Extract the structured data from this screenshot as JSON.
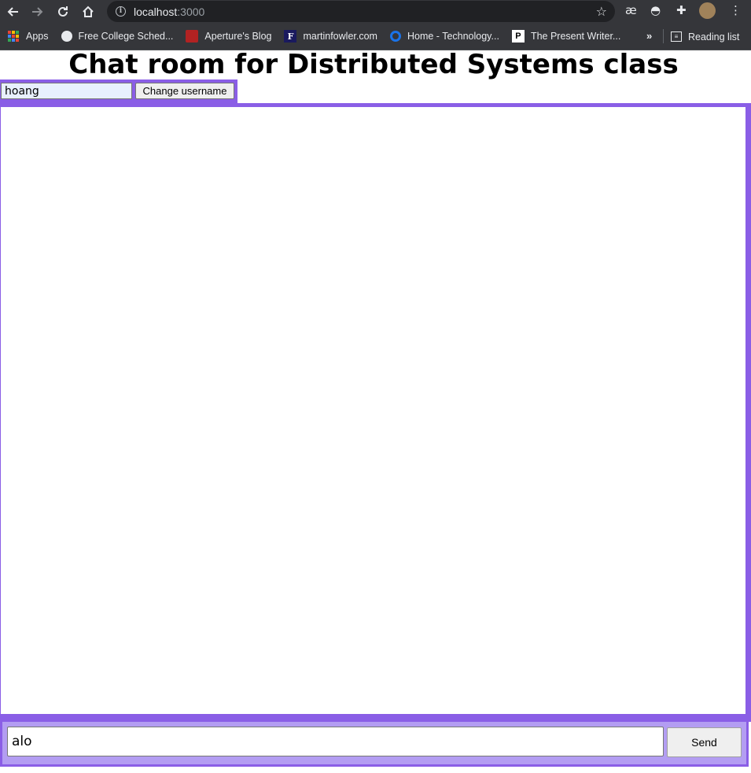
{
  "browser": {
    "url_host": "localhost",
    "url_port": ":3000",
    "bookmarks": [
      {
        "label": "Apps",
        "icon": "apps-grid-icon"
      },
      {
        "label": "Free College Sched...",
        "icon": "globe-icon"
      },
      {
        "label": "Aperture's Blog",
        "icon": "aperture-blog-icon"
      },
      {
        "label": "martinfowler.com",
        "icon": "martinfowler-icon",
        "glyph": "F"
      },
      {
        "label": "Home - Technology...",
        "icon": "technology-home-icon"
      },
      {
        "label": "The Present Writer...",
        "icon": "present-writer-icon",
        "glyph": "P"
      }
    ],
    "overflow_label": "»",
    "reading_list_label": "Reading list",
    "colors": {
      "chrome": "#35363a",
      "omnibox": "#202124"
    }
  },
  "page": {
    "title": "Chat room for Distributed Systems class",
    "username_value": "hoang",
    "change_username_label": "Change username",
    "message_value": "alo",
    "send_label": "Send",
    "colors": {
      "frame": "#8a5ee6",
      "composer": "#b39df2"
    }
  }
}
